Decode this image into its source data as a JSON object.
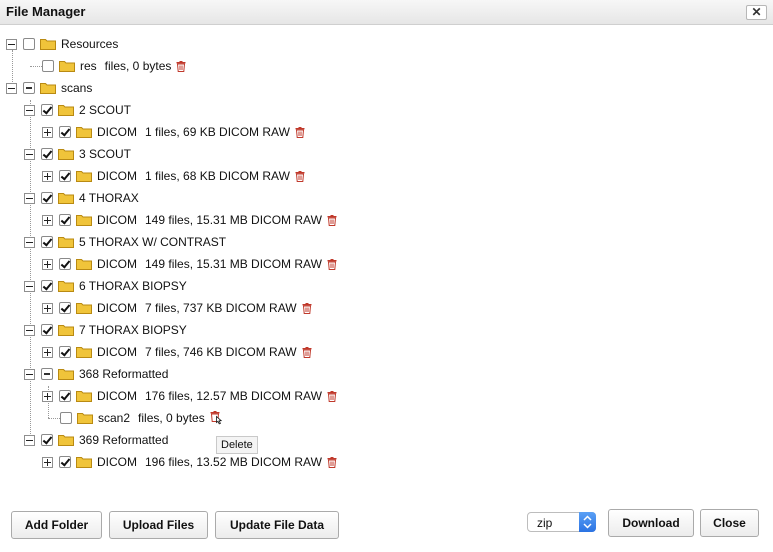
{
  "window": {
    "title": "File Manager",
    "close_glyph": "✕"
  },
  "tree": {
    "resources": {
      "label": "Resources",
      "res": {
        "name": "res",
        "meta": "files, 0 bytes"
      }
    },
    "scans": {
      "label": "scans",
      "items": [
        {
          "name": "2 SCOUT",
          "dicom": "DICOM",
          "meta": "1 files, 69 KB DICOM RAW"
        },
        {
          "name": "3 SCOUT",
          "dicom": "DICOM",
          "meta": "1 files, 68 KB DICOM RAW"
        },
        {
          "name": "4 THORAX",
          "dicom": "DICOM",
          "meta": "149 files, 15.31 MB DICOM RAW"
        },
        {
          "name": "5 THORAX W/ CONTRAST",
          "dicom": "DICOM",
          "meta": "149 files, 15.31 MB DICOM RAW"
        },
        {
          "name": "6 THORAX BIOPSY",
          "dicom": "DICOM",
          "meta": "7 files, 737 KB DICOM RAW"
        },
        {
          "name": "7 THORAX BIOPSY",
          "dicom": "DICOM",
          "meta": "7 files, 746 KB DICOM RAW"
        },
        {
          "name": "368 Reformatted",
          "dicom": "DICOM",
          "meta": "176 files, 12.57 MB DICOM RAW",
          "extra_name": "scan2",
          "extra_meta": "files, 0 bytes"
        },
        {
          "name": "369 Reformatted",
          "dicom": "DICOM",
          "meta": "196 files, 13.52 MB DICOM RAW"
        }
      ]
    }
  },
  "tooltip": "Delete",
  "footer": {
    "add_folder": "Add Folder",
    "upload_files": "Upload Files",
    "update_file_data": "Update File Data",
    "format_select": "zip",
    "download": "Download",
    "close": "Close"
  },
  "colors": {
    "trash": "#c0392b",
    "folder": "#f0c43a",
    "select_arrow": "#2b73e3"
  },
  "icons": {
    "folder": "folder-icon",
    "trash": "trash-icon",
    "expander": "expander-toggle"
  }
}
